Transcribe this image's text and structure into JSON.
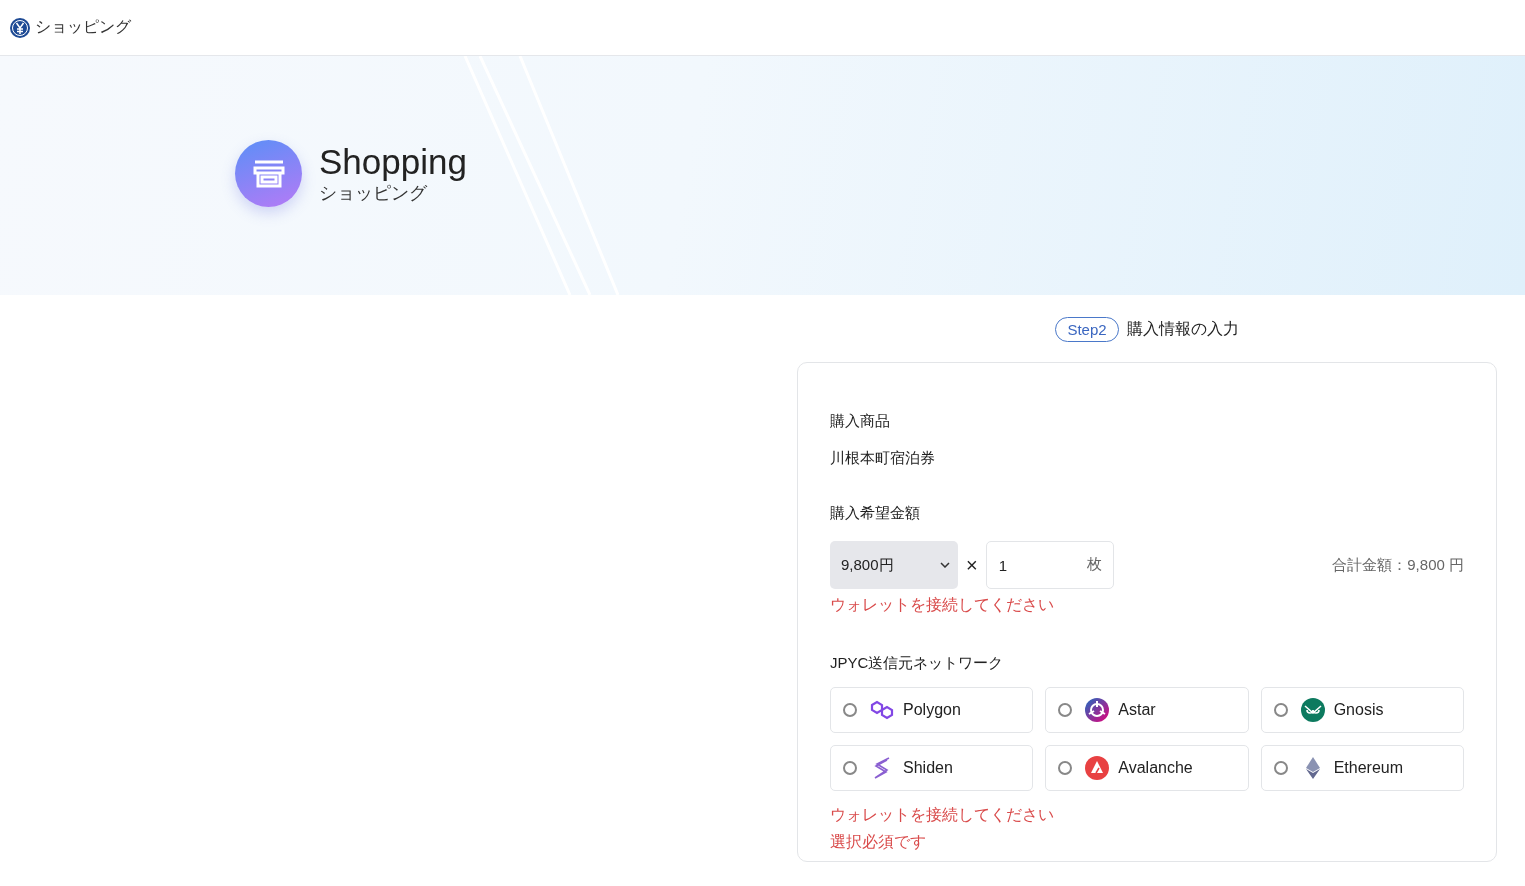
{
  "header": {
    "title": "ショッピング"
  },
  "hero": {
    "title": "Shopping",
    "subtitle": "ショッピング"
  },
  "step": {
    "badge": "Step2",
    "label": "購入情報の入力"
  },
  "form": {
    "product_label": "購入商品",
    "product_value": "川根本町宿泊券",
    "amount_label": "購入希望金額",
    "amount_select": "9,800円",
    "times": "×",
    "quantity": "1",
    "quantity_unit": "枚",
    "total": "合計金額：9,800 円",
    "amount_error": "ウォレットを接続してください",
    "network_label": "JPYC送信元ネットワーク",
    "networks": [
      {
        "name": "Polygon",
        "kind": "polygon",
        "selected": false
      },
      {
        "name": "Astar",
        "kind": "astar",
        "selected": false
      },
      {
        "name": "Gnosis",
        "kind": "gnosis",
        "selected": false
      },
      {
        "name": "Shiden",
        "kind": "shiden",
        "selected": false
      },
      {
        "name": "Avalanche",
        "kind": "avalanche",
        "selected": false
      },
      {
        "name": "Ethereum",
        "kind": "ethereum",
        "selected": false
      }
    ],
    "network_errors": [
      "ウォレットを接続してください",
      "選択必須です"
    ]
  }
}
